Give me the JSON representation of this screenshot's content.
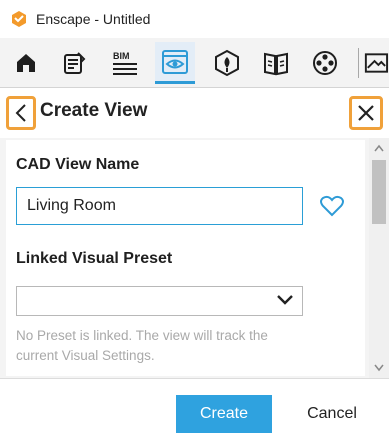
{
  "window": {
    "title": "Enscape - Untitled",
    "logo_icon": "enscape-logo-icon"
  },
  "toolbar": {
    "items": [
      {
        "icon": "home-icon"
      },
      {
        "icon": "notepad-icon"
      },
      {
        "icon": "bim-icon",
        "label": "BIM"
      },
      {
        "icon": "views-eye-icon",
        "active": true
      },
      {
        "icon": "asset-library-icon"
      },
      {
        "icon": "material-book-icon"
      },
      {
        "icon": "video-reel-icon"
      },
      {
        "icon": "export-image-icon"
      }
    ],
    "accent_color": "#2e9bd6"
  },
  "header": {
    "title": "Create View",
    "back_icon": "chevron-left-icon",
    "close_icon": "close-icon",
    "highlight_color": "#f0a13a"
  },
  "form": {
    "name_label": "CAD View Name",
    "name_value": "Living Room",
    "favorite_icon": "heart-icon",
    "preset_label": "Linked Visual Preset",
    "preset_value": "",
    "helper_text": "No Preset is linked. The view will track the current Visual Settings."
  },
  "footer": {
    "create_label": "Create",
    "cancel_label": "Cancel",
    "primary_color": "#2fa2df"
  }
}
